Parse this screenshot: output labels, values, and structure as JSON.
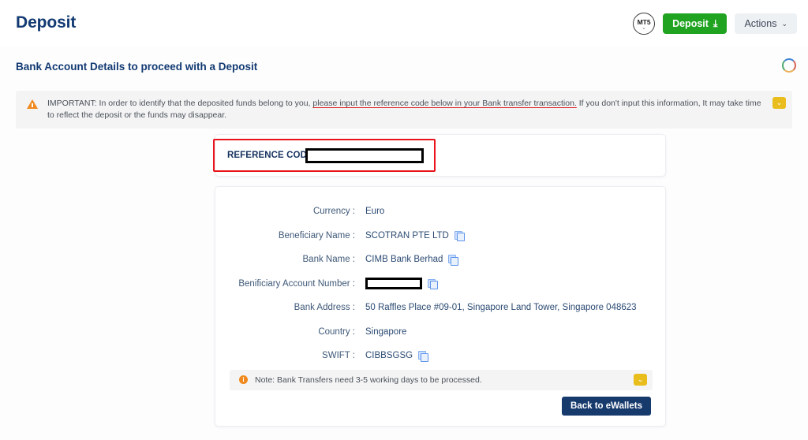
{
  "header": {
    "title": "Deposit",
    "account_badge": {
      "label": "MT5",
      "chevron": "⌄"
    },
    "deposit_button": {
      "label": "Deposit",
      "icon": "⤓"
    },
    "actions_button": {
      "label": "Actions",
      "chevron": "⌄"
    }
  },
  "section": {
    "heading": "Bank Account Details to proceed with a Deposit",
    "spinner": "loading-spinner"
  },
  "important_banner": {
    "icon": "warning-triangle-icon",
    "text_before": "IMPORTANT: In order to identify that the deposited funds belong to you, ",
    "text_underlined": "please input the reference code below in your Bank transfer transaction.",
    "text_after": " If you don't input this information, It may take time to reflect the deposit or the funds may disappear.",
    "collapse_chevron": "⌄"
  },
  "reference": {
    "label": "REFERENCE CODE :",
    "value": ""
  },
  "details": {
    "rows": [
      {
        "label": "Currency :",
        "value": "Euro",
        "copy": false,
        "redacted": false
      },
      {
        "label": "Beneficiary Name :",
        "value": "SCOTRAN PTE LTD",
        "copy": true,
        "redacted": false
      },
      {
        "label": "Bank Name :",
        "value": "CIMB Bank Berhad",
        "copy": true,
        "redacted": false
      },
      {
        "label": "Benificiary Account Number :",
        "value": "",
        "copy": true,
        "redacted": true
      },
      {
        "label": "Bank Address :",
        "value": "50 Raffles Place #09-01, Singapore Land Tower, Singapore 048623",
        "copy": false,
        "redacted": false
      },
      {
        "label": "Country :",
        "value": "Singapore",
        "copy": false,
        "redacted": false
      },
      {
        "label": "SWIFT :",
        "value": "CIBBSGSG",
        "copy": true,
        "redacted": false
      }
    ]
  },
  "note_banner": {
    "icon": "info-icon",
    "icon_glyph": "i",
    "text": "Note: Bank Transfers need 3-5 working days to be processed.",
    "collapse_chevron": "⌄"
  },
  "footer": {
    "back_button": "Back to eWallets"
  },
  "colors": {
    "brand_navy": "#123a72",
    "deposit_green": "#20a320",
    "warning_orange": "#f08a1e",
    "highlight_red": "#e8131b",
    "chevron_yellow": "#e8bd1c",
    "back_button_navy": "#173a6d"
  }
}
